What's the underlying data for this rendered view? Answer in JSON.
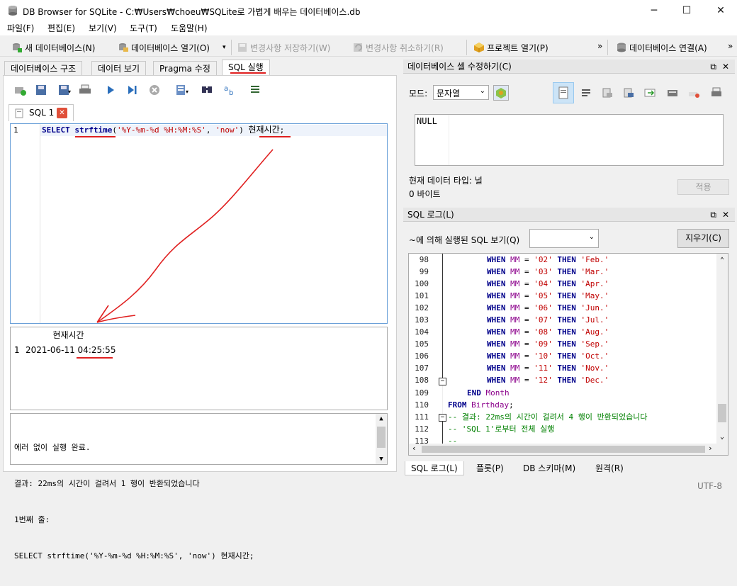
{
  "window": {
    "title": "DB Browser for SQLite - C:₩Users₩choeu₩SQLite로 가볍게 배우는 데이터베이스.db",
    "min": "─",
    "max": "☐",
    "close": "✕"
  },
  "menu": [
    "파일(F)",
    "편집(E)",
    "보기(V)",
    "도구(T)",
    "도움말(H)"
  ],
  "toolbar": {
    "new_db": "새 데이터베이스(N)",
    "open_db": "데이터베이스 열기(O)",
    "write_changes": "변경사항 저장하기(W)",
    "revert_changes": "변경사항 취소하기(R)",
    "open_project": "프로젝트 열기(P)",
    "more1": "»",
    "attach_db": "데이터베이스 연결(A)",
    "more2": "»"
  },
  "tabs": [
    "데이터베이스 구조",
    "데이터 보기",
    "Pragma 수정",
    "SQL 실행"
  ],
  "sql_tab": {
    "name": "SQL 1",
    "close": "✕"
  },
  "editor": {
    "line_number": "1",
    "code": {
      "kw": "SELECT",
      "fn": "strftime",
      "open": "(",
      "arg1": "'%Y-%m-%d %H:%M:%S'",
      "comma": ", ",
      "arg2": "'now'",
      "close": ")",
      "alias": "현재시간",
      "semi": ";"
    }
  },
  "results": {
    "header": "현재시간",
    "row_num": "1",
    "value": "2021-06-11 04:25:55"
  },
  "messages": [
    "에러 없이 실행 완료.",
    "결과: 22ms의 시간이 걸려서 1 행이 반환되었습니다",
    "1번째 줄:",
    "SELECT strftime('%Y-%m-%d %H:%M:%S', 'now') 현재시간;"
  ],
  "cell_editor": {
    "title": "데이터베이스 셀 수정하기(C)",
    "mode_label": "모드:",
    "mode_value": "문자열",
    "content": "NULL",
    "type_label": "현재 데이터 타입: 널",
    "size_label": "0 바이트",
    "apply": "적용"
  },
  "sql_log": {
    "title": "SQL 로그(L)",
    "filter_label": "~에 의해 실행된 SQL 보기(Q)",
    "clear": "지우기(C)",
    "lines": [
      {
        "n": "98",
        "mm": "'02'",
        "mon": "'Feb.'"
      },
      {
        "n": "99",
        "mm": "'03'",
        "mon": "'Mar.'"
      },
      {
        "n": "100",
        "mm": "'04'",
        "mon": "'Apr.'"
      },
      {
        "n": "101",
        "mm": "'05'",
        "mon": "'May.'"
      },
      {
        "n": "102",
        "mm": "'06'",
        "mon": "'Jun.'"
      },
      {
        "n": "103",
        "mm": "'07'",
        "mon": "'Jul.'"
      },
      {
        "n": "104",
        "mm": "'08'",
        "mon": "'Aug.'"
      },
      {
        "n": "105",
        "mm": "'09'",
        "mon": "'Sep.'"
      },
      {
        "n": "106",
        "mm": "'10'",
        "mon": "'Oct.'"
      },
      {
        "n": "107",
        "mm": "'11'",
        "mon": "'Nov.'"
      },
      {
        "n": "108",
        "mm": "'12'",
        "mon": "'Dec.'"
      }
    ],
    "kw_when": "WHEN",
    "kw_mm": "MM",
    "kw_eq": " = ",
    "kw_then": "THEN",
    "line109": {
      "n": "109",
      "kw": "END",
      "id": "Month"
    },
    "line110": {
      "n": "110",
      "kw": "FROM",
      "id": "Birthday",
      "semi": ";"
    },
    "line111": {
      "n": "111",
      "text": "-- 결과: 22ms의 시간이 걸려서 4 행이 반환되었습니다"
    },
    "line112": {
      "n": "112",
      "text": "-- 'SQL 1'로부터 전체 실행"
    },
    "line113": {
      "n": "113",
      "text": "--"
    }
  },
  "bottom_tabs": [
    "SQL 로그(L)",
    "플롯(P)",
    "DB 스키마(M)",
    "원격(R)"
  ],
  "status": {
    "encoding": "UTF-8"
  },
  "colors": {
    "accent": "#0078d7",
    "annotation": "#e02020",
    "keyword": "#00008b",
    "string": "#c00000",
    "comment": "#008000"
  }
}
